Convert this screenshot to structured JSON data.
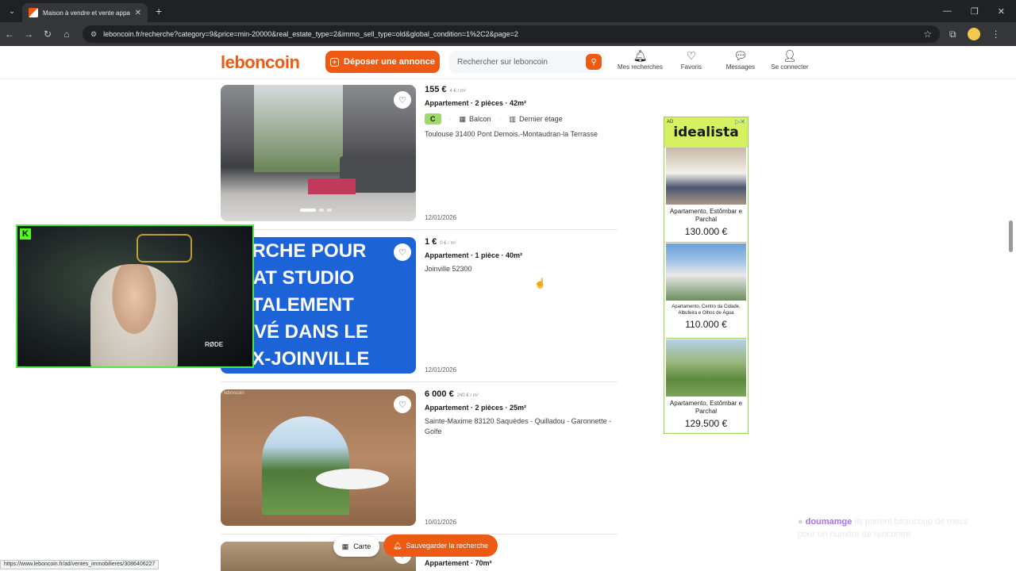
{
  "browser": {
    "tab_title": "Maison à vendre et vente appa",
    "url": "leboncoin.fr/recherche?category=9&price=min-20000&real_estate_type=2&immo_sell_type=old&global_condition=1%2C2&page=2",
    "status_url": "https://www.leboncoin.fr/ad/ventes_immobilieres/3086406227"
  },
  "header": {
    "logo": "leboncoin",
    "post_button": "Déposer une annonce",
    "search_placeholder": "Rechercher sur leboncoin",
    "icons": [
      {
        "label": "Mes recherches",
        "icon": "bell-icon"
      },
      {
        "label": "Favoris",
        "icon": "heart-icon"
      },
      {
        "label": "Messages",
        "icon": "message-icon"
      },
      {
        "label": "Se connecter",
        "icon": "user-icon"
      }
    ]
  },
  "listings": [
    {
      "price": "155 €",
      "price_per_m2": "4 € / m²",
      "type": "Appartement · 2 pièces · 42m²",
      "dpe": "C",
      "tags": [
        "Balcon",
        "Dernier étage"
      ],
      "location": "Toulouse 31400 Pont Demois.-Montaudran-la Terrasse",
      "date": "12/01/2026"
    },
    {
      "price": "1 €",
      "price_per_m2": "0 € / m²",
      "type": "Appartement · 1 pièce · 40m²",
      "location": "Joinville 52300",
      "date": "12/01/2026",
      "image_text": [
        "HERCHE POUR",
        "CHAT STUDIO",
        "TOTALEMENT",
        "NOVÉ DANS LE",
        "EUX-JOINVILLE"
      ]
    },
    {
      "price": "6 000 €",
      "price_per_m2": "240 € / m²",
      "type": "Appartement · 2 pièces · 25m²",
      "location": "Sainte-Maxime 83120 Saquèdes - Quilladou - Garonnette - Golfe",
      "date": "10/01/2026",
      "watermark": "leboncoin"
    },
    {
      "type": "Appartement · 70m²"
    }
  ],
  "ad": {
    "label": "AD",
    "brand": "idealista",
    "cards": [
      {
        "title": "Apartamento, Estômbar e Parchal",
        "price": "130.000 €"
      },
      {
        "title": "Apartamento, Centro da Cidade, Albufeira e Olhos de Água",
        "price": "110.000 €"
      },
      {
        "title": "Apartamento, Estômbar e Parchal",
        "price": "129.500 €"
      }
    ]
  },
  "bottom": {
    "map_label": "Carte",
    "save_label": "Sauvegarder la recherche"
  },
  "chat": {
    "user": "doumamge",
    "message": "ils parlent beaucoup de mecs pour un numéro de rencontre"
  },
  "webcam": {
    "mic_label": "RØDE",
    "platform_badge": "K"
  }
}
